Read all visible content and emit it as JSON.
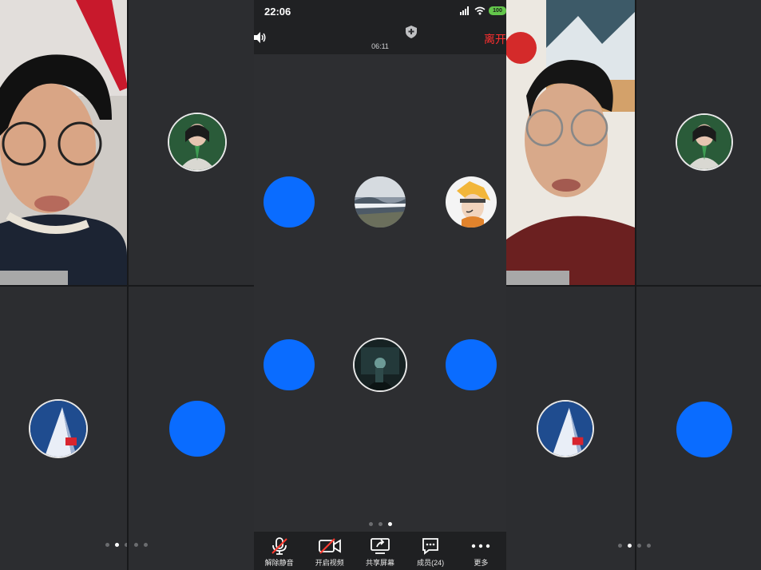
{
  "status_bar": {
    "time": "22:06",
    "battery": "100"
  },
  "meeting": {
    "duration": "06:11",
    "leave_label": "离开"
  },
  "toolbar": {
    "unmute_label": "解除静音",
    "video_label": "开启视频",
    "share_label": "共享屏幕",
    "members_label": "成员(24)",
    "more_label": "更多"
  },
  "colors": {
    "accent_blue": "#0a6cff",
    "leave_red": "#ff2f2f",
    "battery_green": "#63c64b"
  }
}
